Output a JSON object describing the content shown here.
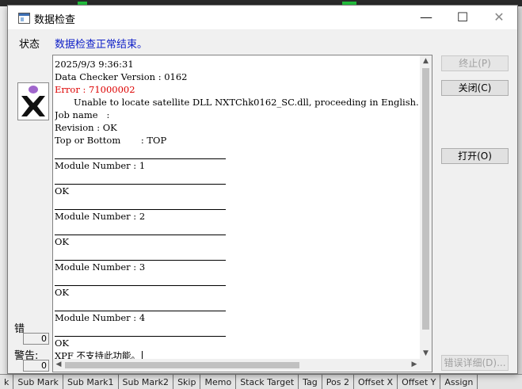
{
  "background_app": {
    "tabs": [
      "k",
      "Sub Mark",
      "Sub Mark1",
      "Sub Mark2",
      "Skip",
      "Memo",
      "Stack Target",
      "Tag",
      "Pos 2",
      "Offset X",
      "Offset Y",
      "Assign"
    ]
  },
  "window": {
    "title": "数据检查",
    "minimize_glyph": "—",
    "maximize_glyph": "☐",
    "close_glyph": "✕"
  },
  "status": {
    "label": "状态",
    "message": "数据检查正常结束。",
    "message_color": "#1021c8"
  },
  "log": {
    "lines": [
      {
        "text": "2025/9/3 9:36:31",
        "kind": "normal"
      },
      {
        "text": "Data Checker Version : 0162",
        "kind": "normal"
      },
      {
        "text": "Error : 71000002",
        "kind": "error"
      },
      {
        "text": "Unable to locate satellite DLL NXTChk0162_SC.dll, proceeding in English.",
        "kind": "indent"
      },
      {
        "text": "Job name   :",
        "kind": "normal"
      },
      {
        "text": "Revision : OK",
        "kind": "normal"
      },
      {
        "text": "Top or Bottom       : TOP",
        "kind": "normal"
      },
      {
        "text": "",
        "kind": "sep"
      },
      {
        "text": "Module Number : 1",
        "kind": "normal"
      },
      {
        "text": "",
        "kind": "sep"
      },
      {
        "text": "OK",
        "kind": "normal"
      },
      {
        "text": "",
        "kind": "sep"
      },
      {
        "text": "Module Number : 2",
        "kind": "normal"
      },
      {
        "text": "",
        "kind": "sep"
      },
      {
        "text": "OK",
        "kind": "normal"
      },
      {
        "text": "",
        "kind": "sep"
      },
      {
        "text": "Module Number : 3",
        "kind": "normal"
      },
      {
        "text": "",
        "kind": "sep"
      },
      {
        "text": "OK",
        "kind": "normal"
      },
      {
        "text": "",
        "kind": "sep"
      },
      {
        "text": "Module Number : 4",
        "kind": "normal"
      },
      {
        "text": "",
        "kind": "sep"
      },
      {
        "text": "OK",
        "kind": "normal"
      },
      {
        "text": "XPF 不支持此功能。",
        "kind": "last"
      }
    ],
    "error_color": "#dd0000"
  },
  "buttons": {
    "stop": "终止(P)",
    "close": "关闭(C)",
    "open": "打开(O)",
    "details": "错误详细(D)..."
  },
  "counters": {
    "error_label": "错",
    "error_count": "0",
    "warning_label": "警告:",
    "warning_count": "0"
  },
  "colors": {
    "logo_dot": "#a066cc",
    "accent_green": "#23c43e"
  }
}
